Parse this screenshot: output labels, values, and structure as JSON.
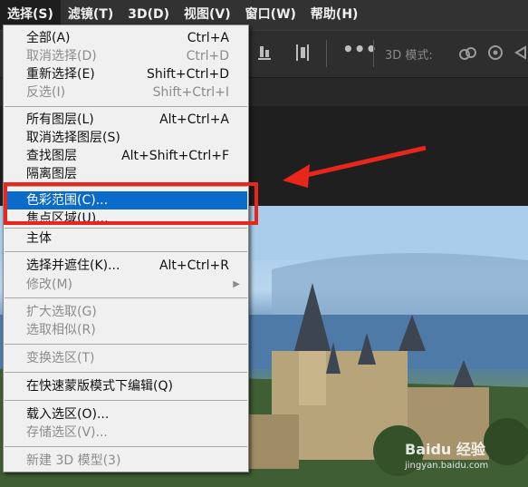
{
  "menubar": {
    "items": [
      {
        "label": "选择(S)"
      },
      {
        "label": "滤镜(T)"
      },
      {
        "label": "3D(D)"
      },
      {
        "label": "视图(V)"
      },
      {
        "label": "窗口(W)"
      },
      {
        "label": "帮助(H)"
      }
    ]
  },
  "optbar": {
    "mode_label": "3D 模式:"
  },
  "menu": {
    "items": [
      {
        "label": "全部(A)",
        "shortcut": "Ctrl+A",
        "disabled": false
      },
      {
        "label": "取消选择(D)",
        "shortcut": "Ctrl+D",
        "disabled": true
      },
      {
        "label": "重新选择(E)",
        "shortcut": "Shift+Ctrl+D",
        "disabled": false
      },
      {
        "label": "反选(I)",
        "shortcut": "Shift+Ctrl+I",
        "disabled": true
      },
      {
        "label": "所有图层(L)",
        "shortcut": "Alt+Ctrl+A",
        "disabled": false
      },
      {
        "label": "取消选择图层(S)",
        "shortcut": "",
        "disabled": false
      },
      {
        "label": "查找图层",
        "shortcut": "Alt+Shift+Ctrl+F",
        "disabled": false
      },
      {
        "label": "隔离图层",
        "shortcut": "",
        "disabled": false
      },
      {
        "label": "色彩范围(C)...",
        "shortcut": "",
        "disabled": false,
        "highlighted": true
      },
      {
        "label": "焦点区域(U)...",
        "shortcut": "",
        "disabled": false
      },
      {
        "label": "主体",
        "shortcut": "",
        "disabled": false
      },
      {
        "label": "选择并遮住(K)...",
        "shortcut": "Alt+Ctrl+R",
        "disabled": false
      },
      {
        "label": "修改(M)",
        "shortcut": "",
        "disabled": true,
        "submenu": true
      },
      {
        "label": "扩大选取(G)",
        "shortcut": "",
        "disabled": true
      },
      {
        "label": "选取相似(R)",
        "shortcut": "",
        "disabled": true
      },
      {
        "label": "变换选区(T)",
        "shortcut": "",
        "disabled": true
      },
      {
        "label": "在快速蒙版模式下编辑(Q)",
        "shortcut": "",
        "disabled": false
      },
      {
        "label": "载入选区(O)...",
        "shortcut": "",
        "disabled": false
      },
      {
        "label": "存储选区(V)...",
        "shortcut": "",
        "disabled": true
      },
      {
        "label": "新建 3D 模型(3)",
        "shortcut": "",
        "disabled": true
      }
    ]
  },
  "watermark": {
    "text1": "Baidu 经验",
    "text2": "jingyan.baidu.com"
  },
  "colors": {
    "highlight": "#0b6bcb",
    "annotation": "#e8261c"
  }
}
